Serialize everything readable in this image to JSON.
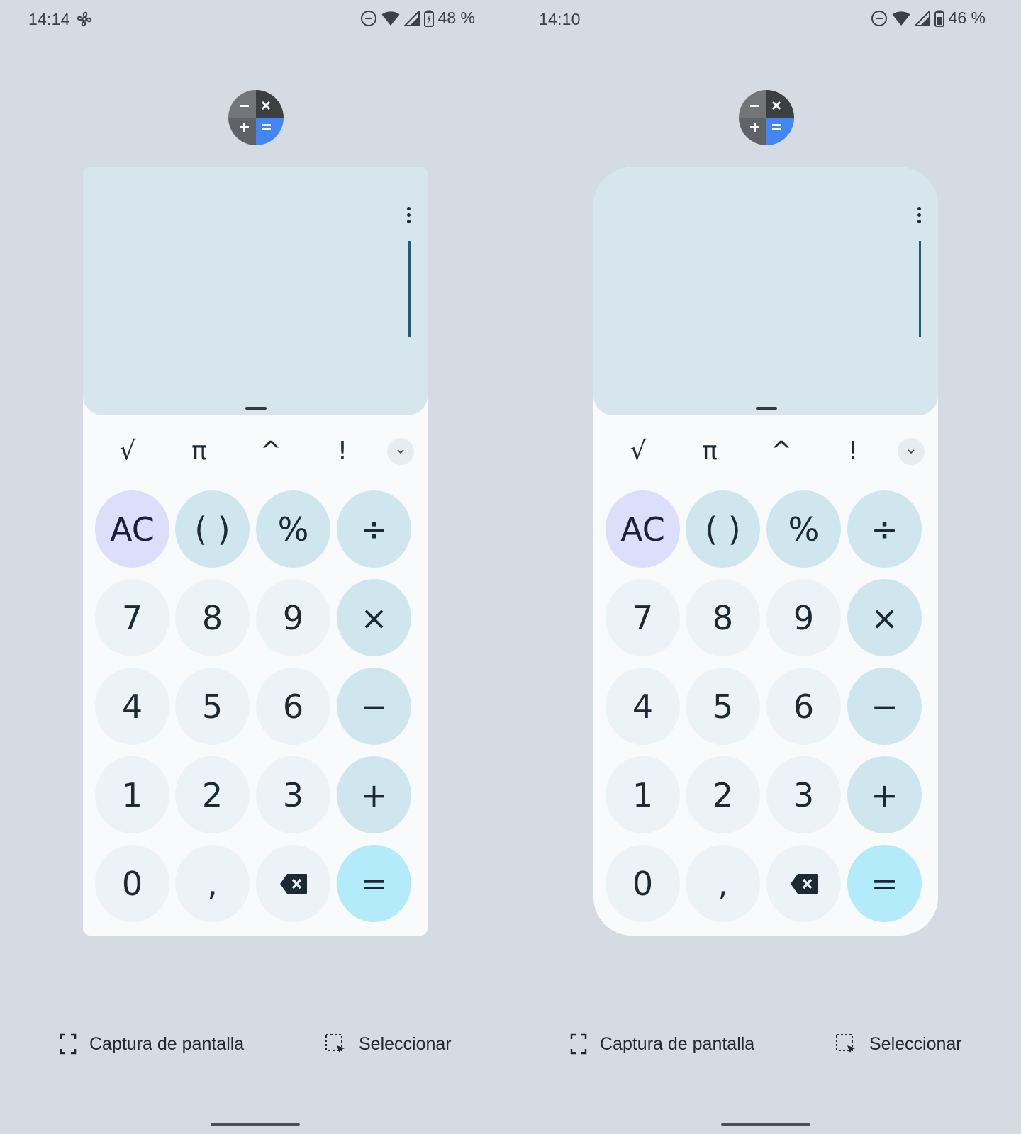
{
  "screens": [
    {
      "status": {
        "time": "14:14",
        "battery": "48 %"
      },
      "keys": {
        "sci": [
          "√",
          "π",
          "^",
          "!"
        ],
        "rows": [
          [
            "AC",
            "( )",
            "%",
            "÷"
          ],
          [
            "7",
            "8",
            "9",
            "×"
          ],
          [
            "4",
            "5",
            "6",
            "−"
          ],
          [
            "1",
            "2",
            "3",
            "+"
          ],
          [
            "0",
            ",",
            "backspace",
            "="
          ]
        ]
      },
      "actions": {
        "capture": "Captura de pantalla",
        "select": "Seleccionar"
      }
    },
    {
      "status": {
        "time": "14:10",
        "battery": "46 %"
      },
      "keys": {
        "sci": [
          "√",
          "π",
          "^",
          "!"
        ],
        "rows": [
          [
            "AC",
            "( )",
            "%",
            "÷"
          ],
          [
            "7",
            "8",
            "9",
            "×"
          ],
          [
            "4",
            "5",
            "6",
            "−"
          ],
          [
            "1",
            "2",
            "3",
            "+"
          ],
          [
            "0",
            ",",
            "backspace",
            "="
          ]
        ]
      },
      "actions": {
        "capture": "Captura de pantalla",
        "select": "Seleccionar"
      }
    }
  ],
  "colors": {
    "background": "#d4dbe2",
    "display": "#d6e6ec",
    "number_key": "#ecf3f6",
    "operator_key": "#d0e6ee",
    "clear_key": "#dcdff9",
    "equals_key": "#b3ebfb",
    "cursor": "#1a5f77",
    "icon_blue": "#4285f4"
  },
  "icons": [
    "fan-icon",
    "do-not-disturb-icon",
    "wifi-icon",
    "signal-icon",
    "battery-icon",
    "more-vert-icon",
    "chevron-down-icon",
    "backspace-icon",
    "screenshot-icon",
    "select-region-icon",
    "calculator-app-icon"
  ]
}
